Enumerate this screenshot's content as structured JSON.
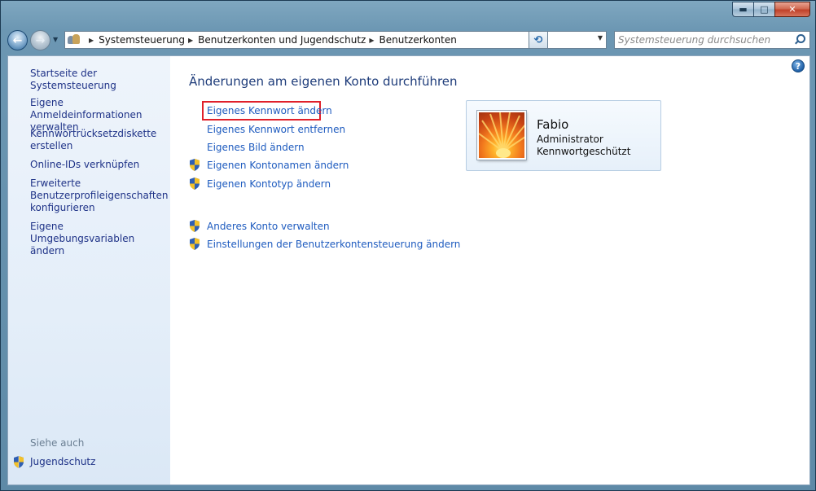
{
  "window": {
    "caption_buttons": {
      "minimize": "▬",
      "maximize": "□",
      "close": "✕"
    }
  },
  "navigation": {
    "back_icon": "arrow-left-icon",
    "forward_icon": "arrow-right-icon",
    "recent_dropdown": "▼",
    "breadcrumbs": [
      "Systemsteuerung",
      "Benutzerkonten und Jugendschutz",
      "Benutzerkonten"
    ],
    "crumb_separator": "▶",
    "address_dropdown": "▼",
    "refresh_glyph": "⟲",
    "search_placeholder": "Systemsteuerung durchsuchen"
  },
  "sidebar": {
    "items": [
      "Startseite der Systemsteuerung",
      "Eigene Anmeldeinformationen verwalten",
      "Kennwortrücksetzdiskette erstellen",
      "Online-IDs verknüpfen",
      "Erweiterte Benutzerprofileigenschaften konfigurieren",
      "Eigene Umgebungsvariablen ändern"
    ],
    "see_also": {
      "heading": "Siehe auch",
      "items": [
        "Jugendschutz"
      ]
    }
  },
  "main": {
    "help": "?",
    "title": "Änderungen am eigenen Konto durchführen",
    "tasks": [
      {
        "label": "Eigenes Kennwort ändern",
        "shield": false,
        "highlighted": true
      },
      {
        "label": "Eigenes Kennwort entfernen",
        "shield": false
      },
      {
        "label": "Eigenes Bild ändern",
        "shield": false
      },
      {
        "label": "Eigenen Kontonamen ändern",
        "shield": true
      },
      {
        "label": "Eigenen Kontotyp ändern",
        "shield": true
      }
    ],
    "other_tasks": [
      {
        "label": "Anderes Konto verwalten",
        "shield": true
      },
      {
        "label": "Einstellungen der Benutzerkontensteuerung ändern",
        "shield": true
      }
    ],
    "account": {
      "name": "Fabio",
      "type": "Administrator",
      "status": "Kennwortgeschützt"
    }
  },
  "colors": {
    "link": "#1e5bbf",
    "sidebar_link": "#1e3287",
    "title": "#1e3c7a",
    "highlight": "#e0202a"
  }
}
